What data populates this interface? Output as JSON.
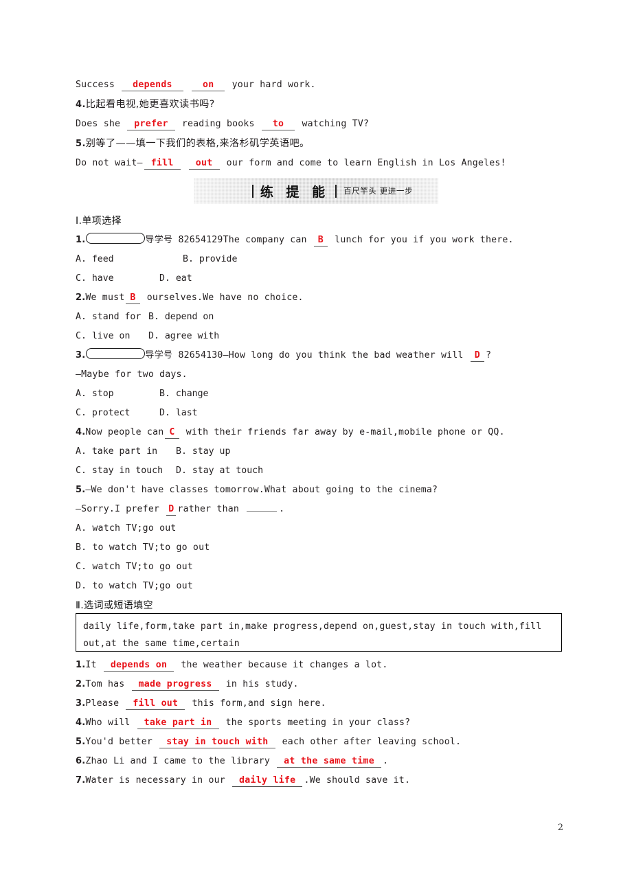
{
  "page": {
    "number": "2"
  },
  "top_translation": {
    "line_1_success": {
      "pre": "Success",
      "answer_1": "depends",
      "answer_2": "on",
      "post": "your hard work."
    },
    "item_4": {
      "num": "4.",
      "chinese": "比起看电视,她更喜欢读书吗?",
      "en_pre": "Does she",
      "answer_1": "prefer",
      "en_mid": "reading books",
      "answer_2": "to",
      "en_post": "watching TV?"
    },
    "item_5": {
      "num": "5.",
      "chinese": "别等了——填一下我们的表格,来洛杉矶学英语吧。",
      "en_pre": "Do not wait—",
      "answer_1": "fill",
      "answer_2": "out",
      "en_post": "our form and come to learn English in Los Angeles!"
    }
  },
  "banner": {
    "title": "练 提 能",
    "subtitle": "百尺竿头  更进一步"
  },
  "section_1": {
    "heading": "Ⅰ.单项选择",
    "questions": [
      {
        "num": "1.",
        "has_oval": true,
        "daohao_label": "导学号",
        "daohao_number": "82654129",
        "stem_pre": "The company can",
        "answer": "B",
        "stem_post": "lunch for you if you work there.",
        "options": [
          "A. feed",
          "B. provide",
          "C. have",
          "D. eat"
        ]
      },
      {
        "num": "2.",
        "has_oval": false,
        "stem_pre": "We must",
        "answer": "B",
        "stem_post": "ourselves.We have no choice.",
        "options": [
          "A. stand for",
          "B. depend on",
          "C. live on",
          "D. agree with"
        ]
      },
      {
        "num": "3.",
        "has_oval": true,
        "daohao_label": "导学号",
        "daohao_number": "82654130",
        "stem_pre": "—How long do you think the bad weather will",
        "answer": "D",
        "stem_post": "?",
        "stem_line2": "—Maybe for two days.",
        "options": [
          "A. stop",
          "B. change",
          "C. protect",
          "D. last"
        ]
      },
      {
        "num": "4.",
        "has_oval": false,
        "stem_pre": "Now people can",
        "answer": "C",
        "stem_post": "with their friends far away by e-mail,mobile phone or QQ.",
        "options": [
          "A. take part in",
          "B. stay up",
          "C. stay in touch",
          "D. stay at touch"
        ]
      },
      {
        "num": "5.",
        "has_oval": false,
        "stem_line1": "—We don't have classes tomorrow.What about going to the cinema?",
        "stem_pre": "—Sorry.I prefer",
        "answer": "D",
        "stem_post": "rather than",
        "stem_tail": ".",
        "options_stacked": [
          "A. watch TV;go out",
          "B. to watch TV;to go out",
          "C. watch TV;to go out",
          "D. to watch TV;go out"
        ]
      }
    ]
  },
  "section_2": {
    "heading": "Ⅱ.选词或短语填空",
    "wordbank_line1": "daily life,form,take part in,make progress,depend on,guest,stay in touch with,fill",
    "wordbank_line2": "out,at the same time,certain",
    "items": [
      {
        "num": "1.",
        "pre": "It",
        "answer": "depends on",
        "post": "the weather because it changes a lot."
      },
      {
        "num": "2.",
        "pre": "Tom has",
        "answer": "made progress",
        "post": "in his study."
      },
      {
        "num": "3.",
        "pre": "Please",
        "answer": "fill out",
        "post": "this form,and sign here."
      },
      {
        "num": "4.",
        "pre": "Who will",
        "answer": "take part in",
        "post": "the sports meeting in your class?"
      },
      {
        "num": "5.",
        "pre": "You'd better",
        "answer": "stay in touch with",
        "post": "each other after leaving school."
      },
      {
        "num": "6.",
        "pre": "Zhao Li and I came to the library",
        "answer": "at the same time",
        "post": "."
      },
      {
        "num": "7.",
        "pre": "Water is necessary in our",
        "answer": "daily life",
        "post": ".We should save it."
      }
    ]
  },
  "colors": {
    "answer_red": "#e8131a",
    "text": "#231f20",
    "banner_gray": "#d2d2d2"
  }
}
